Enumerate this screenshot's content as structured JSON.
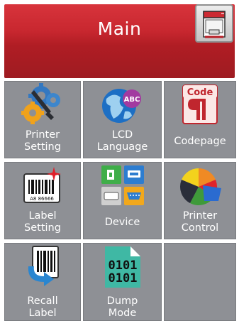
{
  "header": {
    "title": "Main"
  },
  "tiles": [
    {
      "line1": "Printer",
      "line2": "Setting",
      "icon": "gears-icon"
    },
    {
      "line1": "LCD",
      "line2": "Language",
      "icon": "globe-abc-icon",
      "badge": "ABC"
    },
    {
      "line1": "Codepage",
      "line2": "",
      "icon": "codepage-icon",
      "badge": "Code"
    },
    {
      "line1": "Label",
      "line2": "Setting",
      "icon": "barcode-label-icon",
      "badge": "A8 86666"
    },
    {
      "line1": "Device",
      "line2": "",
      "icon": "device-ports-icon"
    },
    {
      "line1": "Printer",
      "line2": "Control",
      "icon": "pie-chart-icon"
    },
    {
      "line1": "Recall",
      "line2": "Label",
      "icon": "recall-label-icon"
    },
    {
      "line1": "Dump",
      "line2": "Mode",
      "icon": "dump-mode-icon",
      "badge": "0101\n0101",
      "badge1": "0101",
      "badge2": "0101"
    }
  ]
}
